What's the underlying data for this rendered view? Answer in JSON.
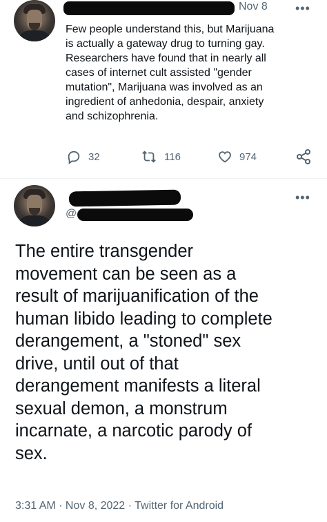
{
  "tweet1": {
    "date": "Nov 8",
    "text": "Few people understand this, but Marijuana\nis actually a gateway drug to turning gay.\nResearchers have found that in nearly all\ncases of internet cult assisted \"gender\nmutation\", Marijuana was involved as an\ningredient of anhedonia, despair, anxiety\nand schizophrenia.",
    "replies": "32",
    "retweets": "116",
    "likes": "974",
    "more": "•••"
  },
  "tweet2": {
    "handle_prefix": "@",
    "more": "•••",
    "text": "The entire transgender\nmovement can be seen as a\nresult of marijuanification of the\nhuman libido leading to complete\nderangement, a \"stoned\" sex\ndrive, until out of that\nderangement manifests a literal\nsexual demon, a monstrum\nincarnate, a narcotic parody of\nsex.",
    "timestamp": "3:31 AM · Nov 8, 2022 · Twitter for Android"
  },
  "icons": [
    "reply-icon",
    "retweet-icon",
    "like-icon",
    "share-icon"
  ],
  "colors": {
    "text": "#0f1419",
    "secondary": "#536471",
    "redaction": "#0b0b0b"
  }
}
